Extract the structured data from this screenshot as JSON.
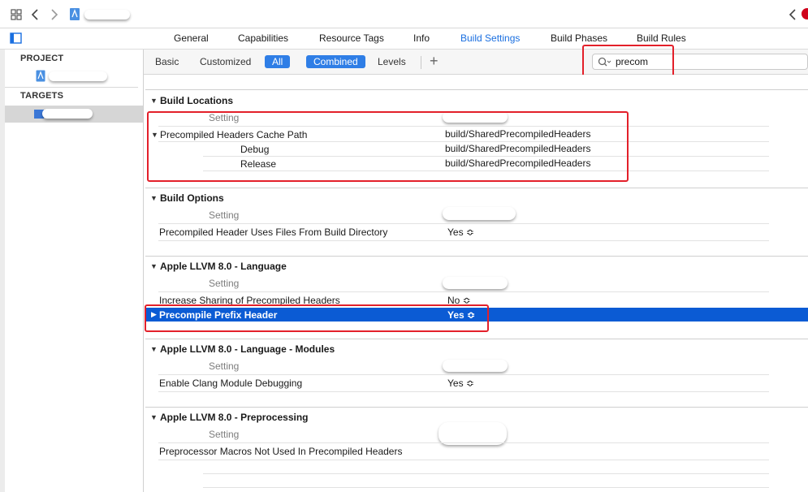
{
  "tabs": [
    "General",
    "Capabilities",
    "Resource Tags",
    "Info",
    "Build Settings",
    "Build Phases",
    "Build Rules"
  ],
  "sidebar": {
    "project_header": "PROJECT",
    "targets_header": "TARGETS"
  },
  "filterbar": {
    "basic": "Basic",
    "customized": "Customized",
    "all": "All",
    "combined": "Combined",
    "levels": "Levels",
    "add": "+",
    "search_value": "precom"
  },
  "sections": {
    "build_locations": {
      "title": "Build Locations",
      "setting_label": "Setting",
      "pch_cache_path": "Precompiled Headers Cache Path",
      "pch_cache_value": "build/SharedPrecompiledHeaders",
      "debug_label": "Debug",
      "debug_value": "build/SharedPrecompiledHeaders",
      "release_label": "Release",
      "release_value": "build/SharedPrecompiledHeaders"
    },
    "build_options": {
      "title": "Build Options",
      "setting_label": "Setting",
      "pch_uses_files": "Precompiled Header Uses Files From Build Directory",
      "pch_uses_files_value": "Yes ≎"
    },
    "llvm_language": {
      "title": "Apple LLVM 8.0 - Language",
      "setting_label": "Setting",
      "increase_sharing": "Increase Sharing of Precompiled Headers",
      "increase_sharing_value": "No ≎",
      "precompile_prefix": "Precompile Prefix Header",
      "precompile_prefix_value": "Yes ≎"
    },
    "llvm_modules": {
      "title": "Apple LLVM 8.0 - Language - Modules",
      "setting_label": "Setting",
      "clang_debugging": "Enable Clang Module Debugging",
      "clang_debugging_value": "Yes ≎"
    },
    "llvm_preprocessing": {
      "title": "Apple LLVM 8.0 - Preprocessing",
      "setting_label": "Setting",
      "macros_not_used": "Preprocessor Macros Not Used In Precompiled Headers"
    }
  },
  "colors": {
    "accent": "#1a6fe0",
    "selection": "#0b5bd4",
    "annotation_red": "#e3202a"
  }
}
